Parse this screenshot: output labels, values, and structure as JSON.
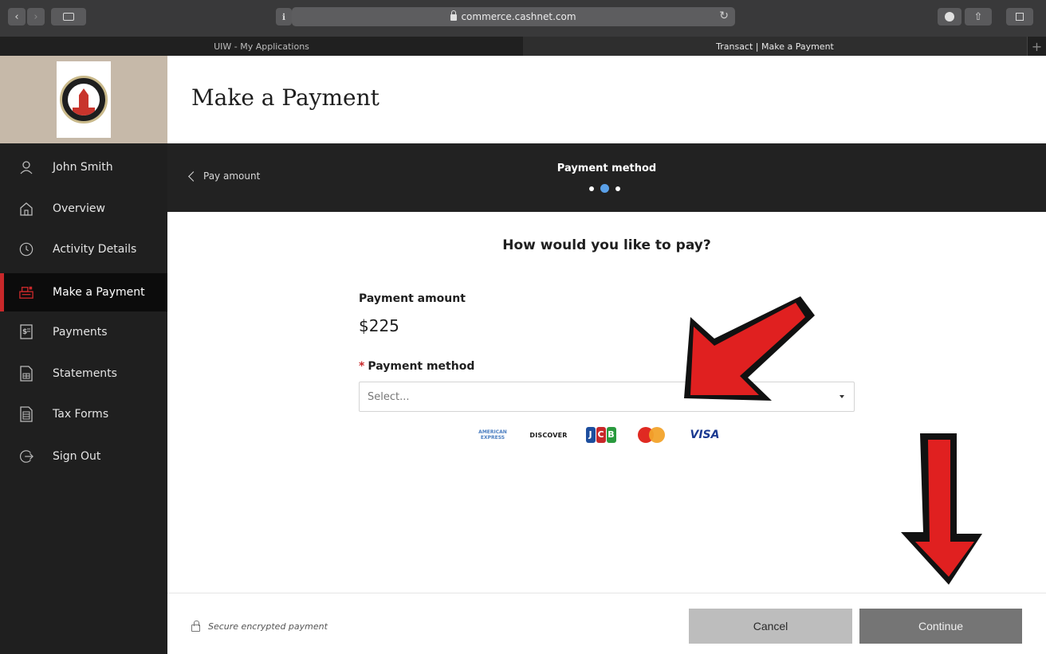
{
  "browser": {
    "url": "commerce.cashnet.com",
    "tabs": [
      {
        "title": "UIW - My Applications",
        "active": false
      },
      {
        "title": "Transact | Make a Payment",
        "active": true
      }
    ]
  },
  "sidebar": {
    "items": [
      {
        "label": "John Smith",
        "icon": "user-icon"
      },
      {
        "label": "Overview",
        "icon": "home-icon"
      },
      {
        "label": "Activity Details",
        "icon": "clock-icon"
      },
      {
        "label": "Make a Payment",
        "icon": "register-icon",
        "active": true
      },
      {
        "label": "Payments",
        "icon": "receipt-icon"
      },
      {
        "label": "Statements",
        "icon": "statement-icon"
      },
      {
        "label": "Tax Forms",
        "icon": "tax-form-icon"
      },
      {
        "label": "Sign Out",
        "icon": "sign-out-icon"
      }
    ]
  },
  "header": {
    "title": "Make a Payment"
  },
  "steps": {
    "back_label": "Pay amount",
    "current_title": "Payment method",
    "total": 3,
    "current_index": 2
  },
  "main": {
    "question": "How would you like to pay?",
    "amount_label": "Payment amount",
    "amount_value": "$225",
    "method_required_mark": "*",
    "method_label": "Payment method",
    "method_placeholder": "Select...",
    "cards": {
      "amex_line1": "AMERICAN",
      "amex_line2": "EXPRESS",
      "discover": "DISCOVER",
      "jcb": [
        "J",
        "C",
        "B"
      ],
      "visa": "VISA"
    }
  },
  "footer": {
    "secure_text": "Secure encrypted payment",
    "cancel_label": "Cancel",
    "continue_label": "Continue"
  },
  "colors": {
    "accent_red": "#c8282a",
    "active_dot": "#5aa0e8",
    "annotation_arrow": "#e02020"
  }
}
